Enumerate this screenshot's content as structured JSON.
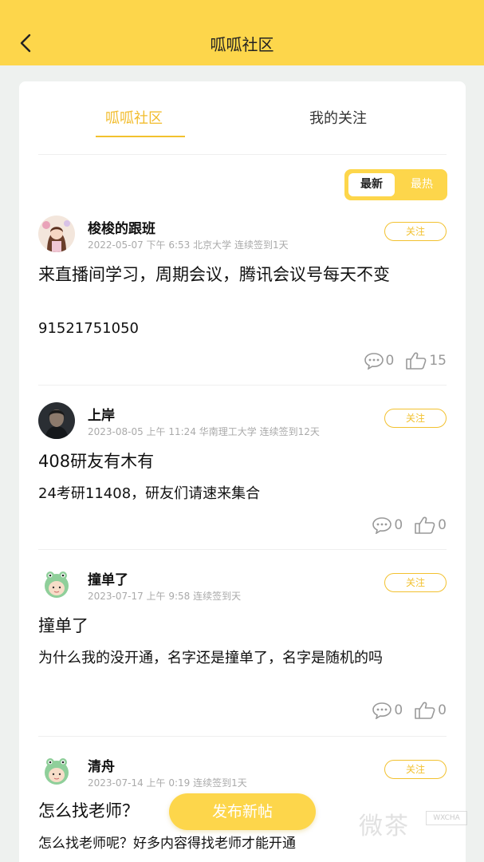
{
  "header": {
    "title": "呱呱社区"
  },
  "tabs": [
    {
      "label": "呱呱社区",
      "active": true
    },
    {
      "label": "我的关注",
      "active": false
    }
  ],
  "sort": {
    "newest_label": "最新",
    "hot_label": "最热",
    "selected": "最新"
  },
  "posts": [
    {
      "username": "梭梭的跟班",
      "meta": "2022-05-07 下午 6:53  北京大学 连续签到1天",
      "follow_label": "关注",
      "title": "来直播间学习，周期会议，腾讯会议号每天不变",
      "body": "91521751050",
      "comments": "0",
      "likes": "15"
    },
    {
      "username": "上岸",
      "meta": "2023-08-05 上午 11:24  华南理工大学 连续签到12天",
      "follow_label": "关注",
      "title": "408研友有木有",
      "body": "24考研11408，研友们请速来集合",
      "comments": "0",
      "likes": "0"
    },
    {
      "username": "撞单了",
      "meta": "2023-07-17 上午 9:58   连续签到天",
      "follow_label": "关注",
      "title": "撞单了",
      "body": "为什么我的没开通，名字还是撞单了，名字是随机的吗",
      "comments": "0",
      "likes": "0"
    },
    {
      "username": "清舟",
      "meta": "2023-07-14 上午 0:19   连续签到1天",
      "follow_label": "关注",
      "title": "怎么找老师？",
      "body": "怎么找老师呢？好多内容得找老师才能开通"
    }
  ],
  "fab": {
    "label": "发布新帖"
  },
  "watermark": {
    "text": "微茶",
    "badge": "WXCHA"
  },
  "colors": {
    "accent": "#fdd64b",
    "accent_text": "#f2bc2c",
    "background": "#eef1ef"
  },
  "icons": {
    "back": "chevron-left-icon",
    "comment": "comment-bubble-icon",
    "like": "thumbs-up-icon"
  }
}
